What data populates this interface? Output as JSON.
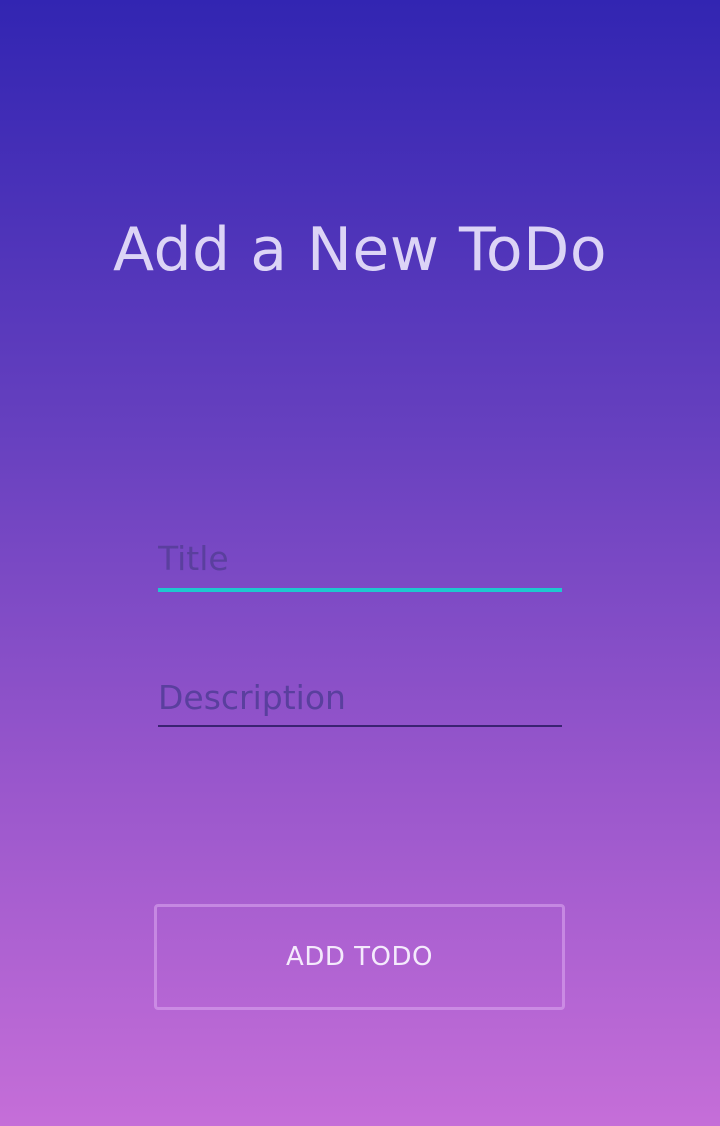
{
  "page": {
    "title": "Add a New ToDo"
  },
  "form": {
    "title_field": {
      "value": "",
      "placeholder": "Title",
      "underline_color": "#1ec8cf"
    },
    "description_field": {
      "value": "",
      "placeholder": "Description",
      "underline_color": "#3a2372"
    },
    "submit_label": "ADD TODO"
  },
  "colors": {
    "gradient_top": "#3225b2",
    "gradient_bottom": "#c56ed8",
    "title_text": "#dcd4f6",
    "accent": "#1ec8cf"
  }
}
